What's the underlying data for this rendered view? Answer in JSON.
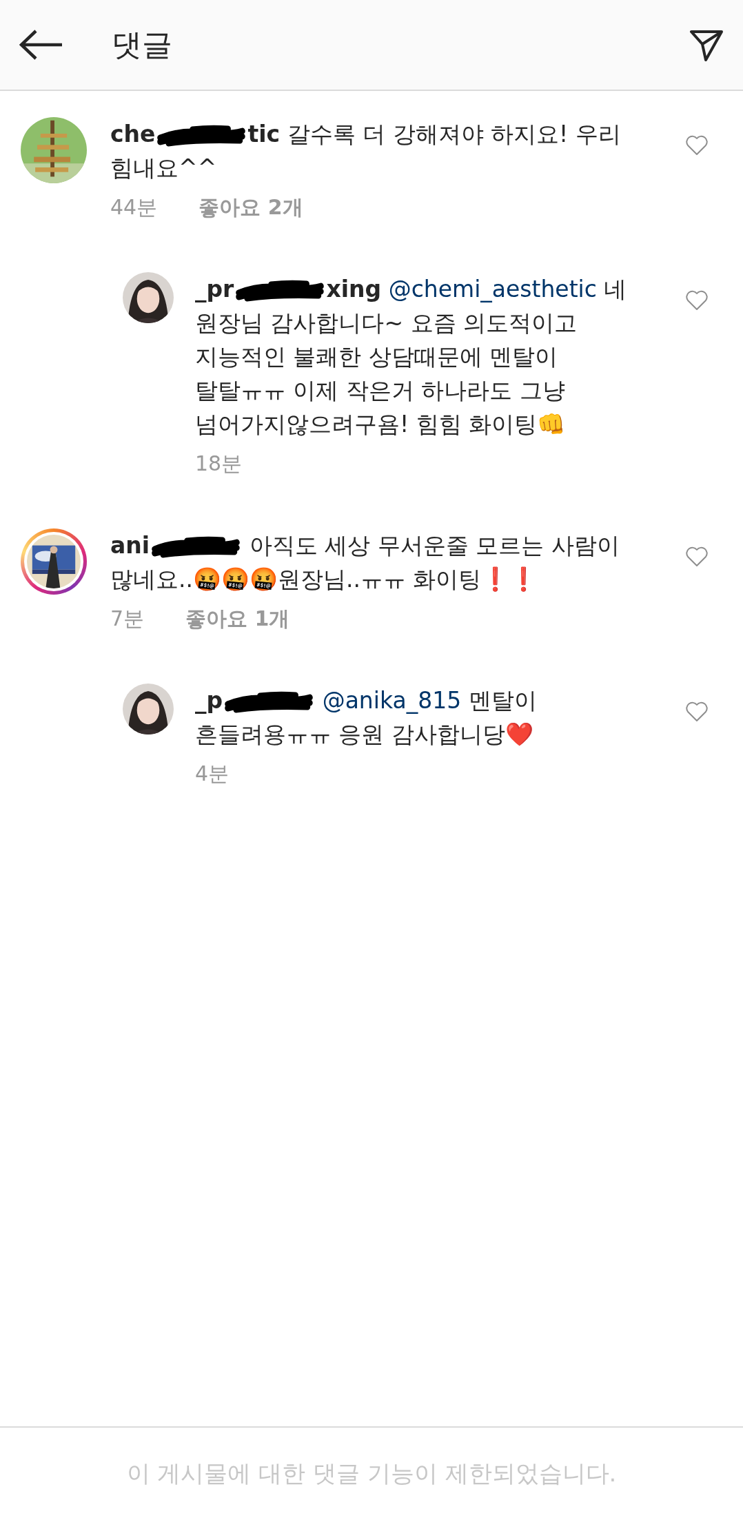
{
  "header": {
    "title": "댓글"
  },
  "comments": [
    {
      "kind": "comment",
      "story_ring": false,
      "user_start": "che",
      "user_end": "tic",
      "text": "갈수록 더 강해져야 하지요! 우리 힘내요^^",
      "time": "44분",
      "likes": "좋아요 2개",
      "liked": false
    },
    {
      "kind": "reply",
      "story_ring": false,
      "user_start": "_pr",
      "user_end": "xing",
      "mention": "@chemi_aesthetic",
      "text": " 네 원장님 감사합니다~  요즘 의도적이고 지능적인 불쾌한 상담때문에 멘탈이 탈탈ㅠㅠ  이제 작은거 하나라도 그냥 넘어가지않으려구욤! 힘힘 화이팅👊",
      "time": "18분",
      "liked": false
    },
    {
      "kind": "comment",
      "story_ring": true,
      "user_start": "ani",
      "text": "아직도 세상 무서운줄 모르는 사람이 많네요..🤬🤬🤬원장님..ㅠㅠ 화이팅❗❗",
      "time": "7분",
      "likes": "좋아요 1개",
      "liked": false
    },
    {
      "kind": "reply",
      "story_ring": false,
      "user_start": "_p",
      "mention": "@anika_815",
      "text": "  멘탈이 흔들려용ㅠㅠ 응원 감사합니당❤️",
      "time": "4분",
      "liked": false
    }
  ],
  "footer": {
    "notice": "이 게시물에 대한 댓글 기능이 제한되었습니다."
  }
}
